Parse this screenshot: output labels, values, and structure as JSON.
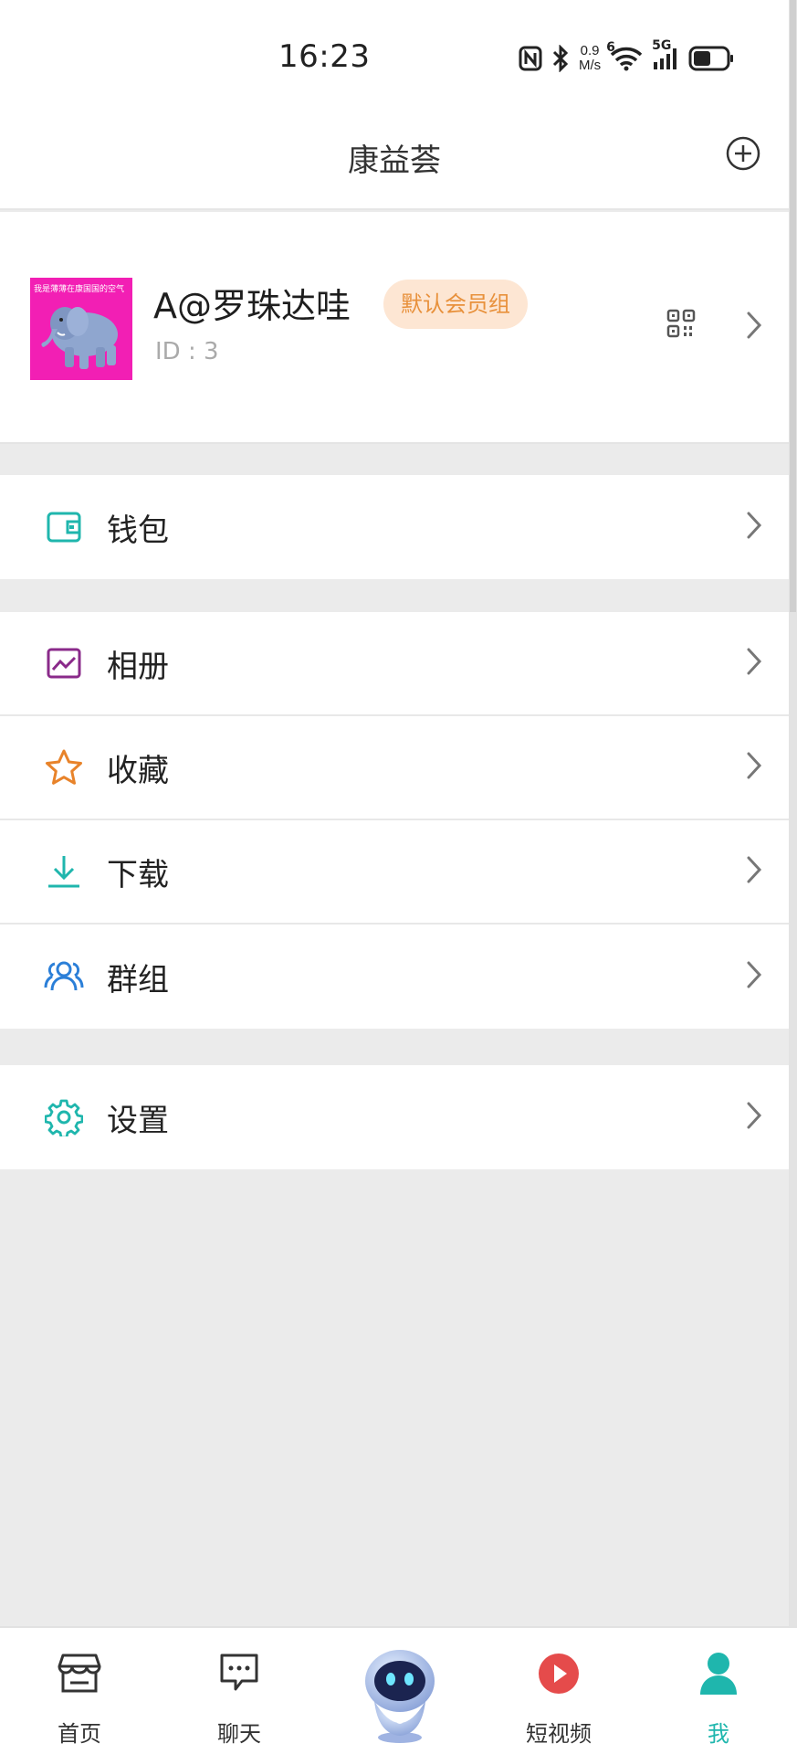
{
  "status_bar": {
    "time": "16:23",
    "net_speed_value": "0.9",
    "net_speed_unit": "M/s",
    "wifi_label": "6",
    "cell_label": "5G",
    "icons": [
      "nfc-icon",
      "bluetooth-icon",
      "wifi-icon",
      "signal-icon",
      "battery-icon"
    ]
  },
  "header": {
    "title": "康益荟",
    "add_icon": "plus-circle-icon"
  },
  "profile": {
    "avatar_caption": "我是薄薄在康国国的空气",
    "username": "A@罗珠达哇",
    "badge": "默认会员组",
    "id_text": "ID : 3",
    "qr_icon": "qr-code-icon",
    "chevron_icon": "chevron-right-icon"
  },
  "menu_groups": [
    {
      "items": [
        {
          "label": "钱包",
          "icon": "wallet-icon",
          "color": "#1fb6ad"
        }
      ]
    },
    {
      "items": [
        {
          "label": "相册",
          "icon": "album-icon",
          "color": "#8a2a8a"
        },
        {
          "label": "收藏",
          "icon": "star-icon",
          "color": "#e8832a"
        },
        {
          "label": "下载",
          "icon": "download-icon",
          "color": "#1fb6ad"
        },
        {
          "label": "群组",
          "icon": "group-icon",
          "color": "#2b7fd8"
        }
      ]
    },
    {
      "items": [
        {
          "label": "设置",
          "icon": "gear-icon",
          "color": "#1fb6ad"
        }
      ]
    }
  ],
  "bottom_nav": [
    {
      "label": "首页",
      "icon": "store-icon",
      "active": false
    },
    {
      "label": "聊天",
      "icon": "chat-icon",
      "active": false
    },
    {
      "label": "",
      "icon": "robot-icon",
      "active": false
    },
    {
      "label": "短视频",
      "icon": "play-icon",
      "active": false,
      "color": "#e54b4b"
    },
    {
      "label": "我",
      "icon": "person-icon",
      "active": true,
      "color": "#1fb6ad"
    }
  ],
  "colors": {
    "accent": "#1fb6ad",
    "badge_bg": "#fde6d3",
    "badge_text": "#e8913c",
    "page_bg": "#ebebeb"
  }
}
